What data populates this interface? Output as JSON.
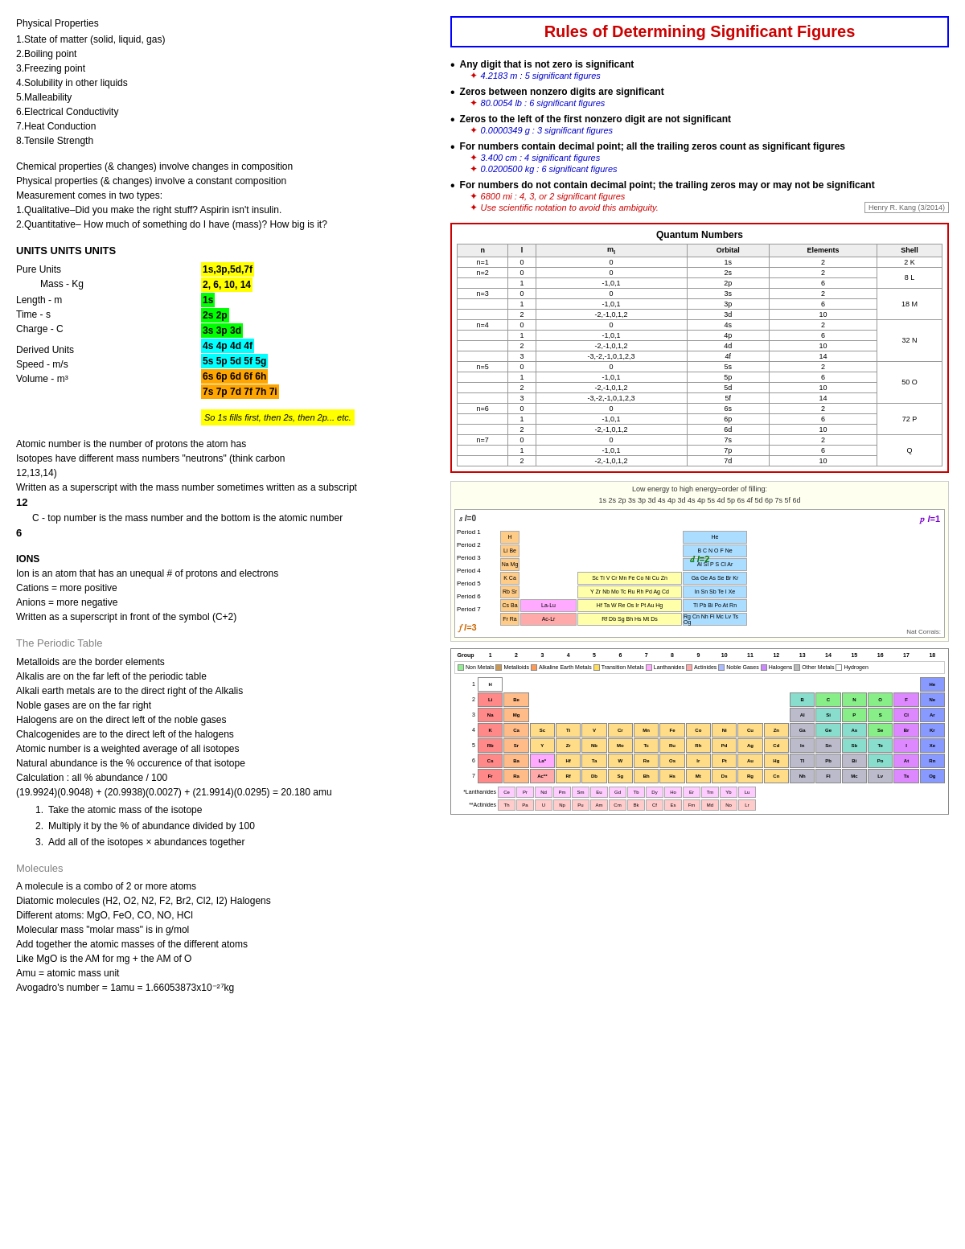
{
  "left": {
    "section1": {
      "title": "Physical Properties",
      "items": [
        "1.State of matter (solid, liquid, gas)",
        "2.Boiling point",
        "3.Freezing point",
        "4.Solubility in other liquids",
        "5.Malleability",
        "6.Electrical Conductivity",
        "7.Heat Conduction",
        "8.Tensile Strength"
      ]
    },
    "section2": {
      "lines": [
        "Chemical properties (& changes) involve changes in composition",
        "Physical properties (& changes) involve a constant composition",
        "Measurement comes in two types:",
        "1.Qualitative–Did you make the right stuff?  Aspirin isn't insulin.",
        "2.Quantitative– How much of something do I have (mass)?  How big is it?"
      ]
    },
    "section3": {
      "label": "UNITS UNITS UNITS",
      "left_items": [
        "Pure Units",
        "      Mass - Kg",
        "Length - m",
        "Time - s",
        "Charge - C",
        "",
        "Derived Units",
        "Speed - m/s",
        "Volume - m³"
      ],
      "right_items": [
        {
          "text": "1s,3p,5d,7f",
          "color": "yellow"
        },
        {
          "text": "2, 6, 10, 14",
          "color": "yellow"
        },
        {
          "text": "1s",
          "color": "green"
        },
        {
          "text": "2s 2p",
          "color": "green"
        },
        {
          "text": "3s 3p 3d",
          "color": "green"
        },
        {
          "text": "4s 4p 4d 4f",
          "color": "cyan"
        },
        {
          "text": "5s 5p 5d 5f 5g",
          "color": "cyan"
        },
        {
          "text": "6s 6p 6d 6f 6h",
          "color": "orange"
        },
        {
          "text": "7s 7p 7d 7f 7h 7i",
          "color": "orange"
        }
      ],
      "note": "So 1s fills first, then 2s, then 2p... etc."
    },
    "section4": {
      "lines": [
        "Atomic number is the number of protons the atom has",
        "Isotopes have different mass numbers \"neutrons\" (think carbon",
        "12,13,14)",
        "Written as a superscript with the mass number sometimes written as a subscript",
        "12",
        "  C - top number is the mass number and the bottom is the atomic number",
        "6"
      ]
    },
    "section5": {
      "title": "IONS",
      "lines": [
        "Ion is an atom that has an unequal # of protons and electrons",
        "Cations = more positive",
        "Anions = more negative",
        "Written as a superscript in front of the symbol (C+2)"
      ]
    },
    "section6": {
      "title": "The Periodic Table",
      "lines": [
        "Metalloids are the border elements",
        "Alkalis are on the far left of the periodic table",
        "Alkali earth metals are to the direct right of the Alkalis",
        "Noble gases are on the far right",
        "Halogens are on the direct left of the noble gases",
        "Chalcogenides are to the direct left of the halogens",
        "Atomic number is a weighted average of all isotopes",
        "Natural abundance is the % occurence of that isotope",
        "Calculation : all % abundance / 100",
        "(19.9924)(0.9048) + (20.9938)(0.0027) + (21.9914)(0.0295) = 20.180 amu"
      ],
      "ol": [
        "Take the atomic mass of the isotope",
        "Multiply it by the % of abundance divided by 100",
        "Add all of the isotopes × abundances together"
      ]
    },
    "section7": {
      "title": "Molecules",
      "lines": [
        "A molecule is a combo of 2 or more atoms",
        "Diatomic molecules (H2, O2, N2, F2, Br2, Cl2, I2) Halogens",
        "Different atoms: MgO, FeO, CO, NO, HCl",
        " Molecular mass \"molar mass\" is in g/mol",
        "Add together the atomic masses of the different atoms",
        "Like MgO is the AM for mg + the AM of O",
        "Amu = atomic mass unit",
        "Avogadro's number = 1amu = 1.66053873x10⁻²⁷kg"
      ]
    }
  },
  "right": {
    "title": "Rules of Determining Significant Figures",
    "rules": [
      {
        "main": "Any digit that is not zero is significant",
        "example": "4.2183 m : 5 significant figures",
        "example_color": "blue"
      },
      {
        "main": "Zeros between nonzero digits are significant",
        "example": "80.0054 lb : 6 significant figures",
        "example_color": "blue"
      },
      {
        "main": "Zeros to the left of the first nonzero digit are not significant",
        "example": "0.0000349 g : 3 significant figures",
        "example_color": "blue"
      },
      {
        "main": "For numbers contain decimal point; all the trailing zeros count as significant figures",
        "examples": [
          "3.400 cm : 4 significant figures",
          "0.0200500 kg : 6 significant figures"
        ],
        "example_color": "blue"
      },
      {
        "main": "For numbers do not contain decimal point; the trailing zeros may or may not be significant",
        "examples": [
          "6800 mi : 4, 3, or 2 significant figures",
          "Use scientific notation to avoid this ambiguity."
        ],
        "example_color": "red",
        "has_attribution": true,
        "attribution": "Henry R. Kang (3/2014)"
      }
    ],
    "quantum_numbers": {
      "title": "Quantum Numbers",
      "headers": [
        "n",
        "l",
        "m_l",
        "Orbital",
        "Elements",
        "Shell"
      ],
      "rows": [
        {
          "n": "n=1",
          "l": "0",
          "ml": "0",
          "orbital": "1s",
          "elements": "2",
          "shell": "2  K"
        },
        {
          "n": "n=2",
          "l": "0",
          "ml": "0",
          "orbital": "2s",
          "elements": "2",
          "shell": ""
        },
        {
          "n": "",
          "l": "1",
          "ml": "-1,0,1",
          "orbital": "2p",
          "elements": "6",
          "shell": "8  L"
        },
        {
          "n": "n=3",
          "l": "0",
          "ml": "0",
          "orbital": "3s",
          "elements": "2",
          "shell": ""
        },
        {
          "n": "",
          "l": "1",
          "ml": "-1,0,1",
          "orbital": "3p",
          "elements": "6",
          "shell": ""
        },
        {
          "n": "",
          "l": "2",
          "ml": "-2,-1,0,1,2",
          "orbital": "3d",
          "elements": "10",
          "shell": "18  M"
        },
        {
          "n": "n=4",
          "l": "0",
          "ml": "0",
          "orbital": "4s",
          "elements": "2",
          "shell": ""
        },
        {
          "n": "",
          "l": "1",
          "ml": "-1,0,1",
          "orbital": "4p",
          "elements": "6",
          "shell": ""
        },
        {
          "n": "",
          "l": "2",
          "ml": "-2,-1,0,1,2",
          "orbital": "4d",
          "elements": "10",
          "shell": "32  N"
        },
        {
          "n": "",
          "l": "3",
          "ml": "-3,-2,-1,0,1,2,3",
          "orbital": "4f",
          "elements": "14",
          "shell": ""
        }
      ]
    },
    "energy_order": "Low energy to high energy=order of filling: 1s 2s 2p 3s 3p 3d 4s 4p 3d 4s 4p 5s 4d 5p 6s 4f 5d 6p 7s 5f 6d",
    "periodic_labels": {
      "s_block": "s l=0",
      "p_block": "p l=1",
      "d_block": "d l=2",
      "f_block": "f l=3",
      "periods": [
        "Period 1",
        "Period 2",
        "Period 3",
        "Period 4",
        "Period 5",
        "Period 6",
        "Period 7"
      ],
      "groups": [
        "Group",
        "1",
        "2",
        "3",
        "4",
        "5",
        "6",
        "7",
        "8",
        "9",
        "10",
        "11",
        "12",
        "13",
        "14",
        "15",
        "16",
        "17",
        "18"
      ]
    },
    "legend": {
      "items": [
        {
          "label": "Non Metals",
          "color": "#90ee90"
        },
        {
          "label": "Metalloids",
          "color": "#cc9966"
        },
        {
          "label": "Alkaline Earth Metals",
          "color": "#ff9966"
        },
        {
          "label": "Transition Metals",
          "color": "#ffcc66"
        },
        {
          "label": "Lanthanides",
          "color": "#ffccff"
        },
        {
          "label": "Actinides",
          "color": "#ffaaaa"
        },
        {
          "label": "Noble Gases",
          "color": "#6699ff"
        },
        {
          "label": "Halogens",
          "color": "#cc66ff"
        },
        {
          "label": "Other Metals",
          "color": "#aaaaaa"
        },
        {
          "label": "Hydrogen",
          "color": "#ffffff"
        }
      ]
    }
  }
}
